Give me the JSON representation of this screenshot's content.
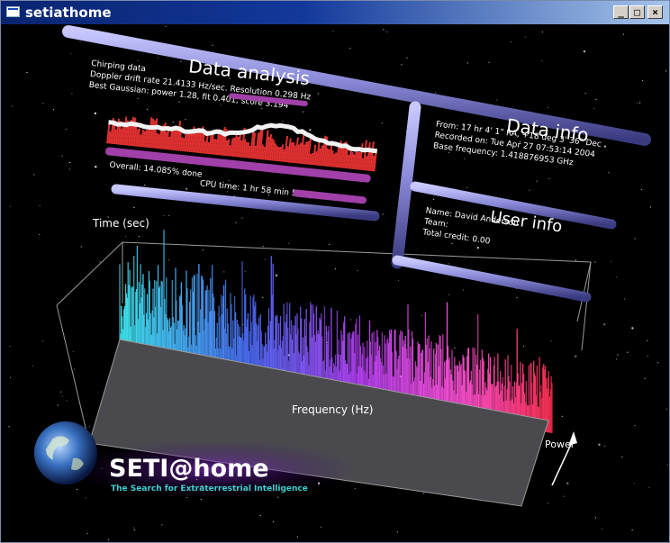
{
  "window": {
    "title": "setiathome",
    "minimize_glyph": "_",
    "maximize_glyph": "□",
    "close_glyph": "×"
  },
  "data_analysis": {
    "heading": "Data analysis",
    "chirping": "Chirping data",
    "doppler": "Doppler drift rate 21.4133 Hz/sec. Resolution 0.298 Hz",
    "gaussian": "Best Gaussian: power 1.28, fit 0.401, score 3.194",
    "overall": "Overall: 14.085% done",
    "cpu_time": "CPU time: 1 hr 58 min 5.11 sec"
  },
  "data_info": {
    "heading": "Data info",
    "from": "From: 17 hr 4' 1\" RA, +18 deg 3' 36\" Dec",
    "recorded": "Recorded on: Tue Apr 27 07:53:14 2004",
    "base_freq": "Base frequency: 1.418876953 GHz"
  },
  "user_info": {
    "heading": "User info",
    "name": "Name: David Anderson",
    "team": "Team: ",
    "credit": "Total credit: 0.00"
  },
  "graph": {
    "time_label": "Time (sec)",
    "frequency_label": "Frequency (Hz)",
    "power_label": "Power"
  },
  "logo": {
    "name": "SETI@home",
    "tagline": "The Search for Extraterrestrial Intelligence"
  },
  "colors": {
    "tube": "#8a8ad8",
    "progress": "#a040a8",
    "spectrum_start": "#40e8f0",
    "spectrum_mid": "#5050f0",
    "spectrum_end": "#ff3050"
  }
}
